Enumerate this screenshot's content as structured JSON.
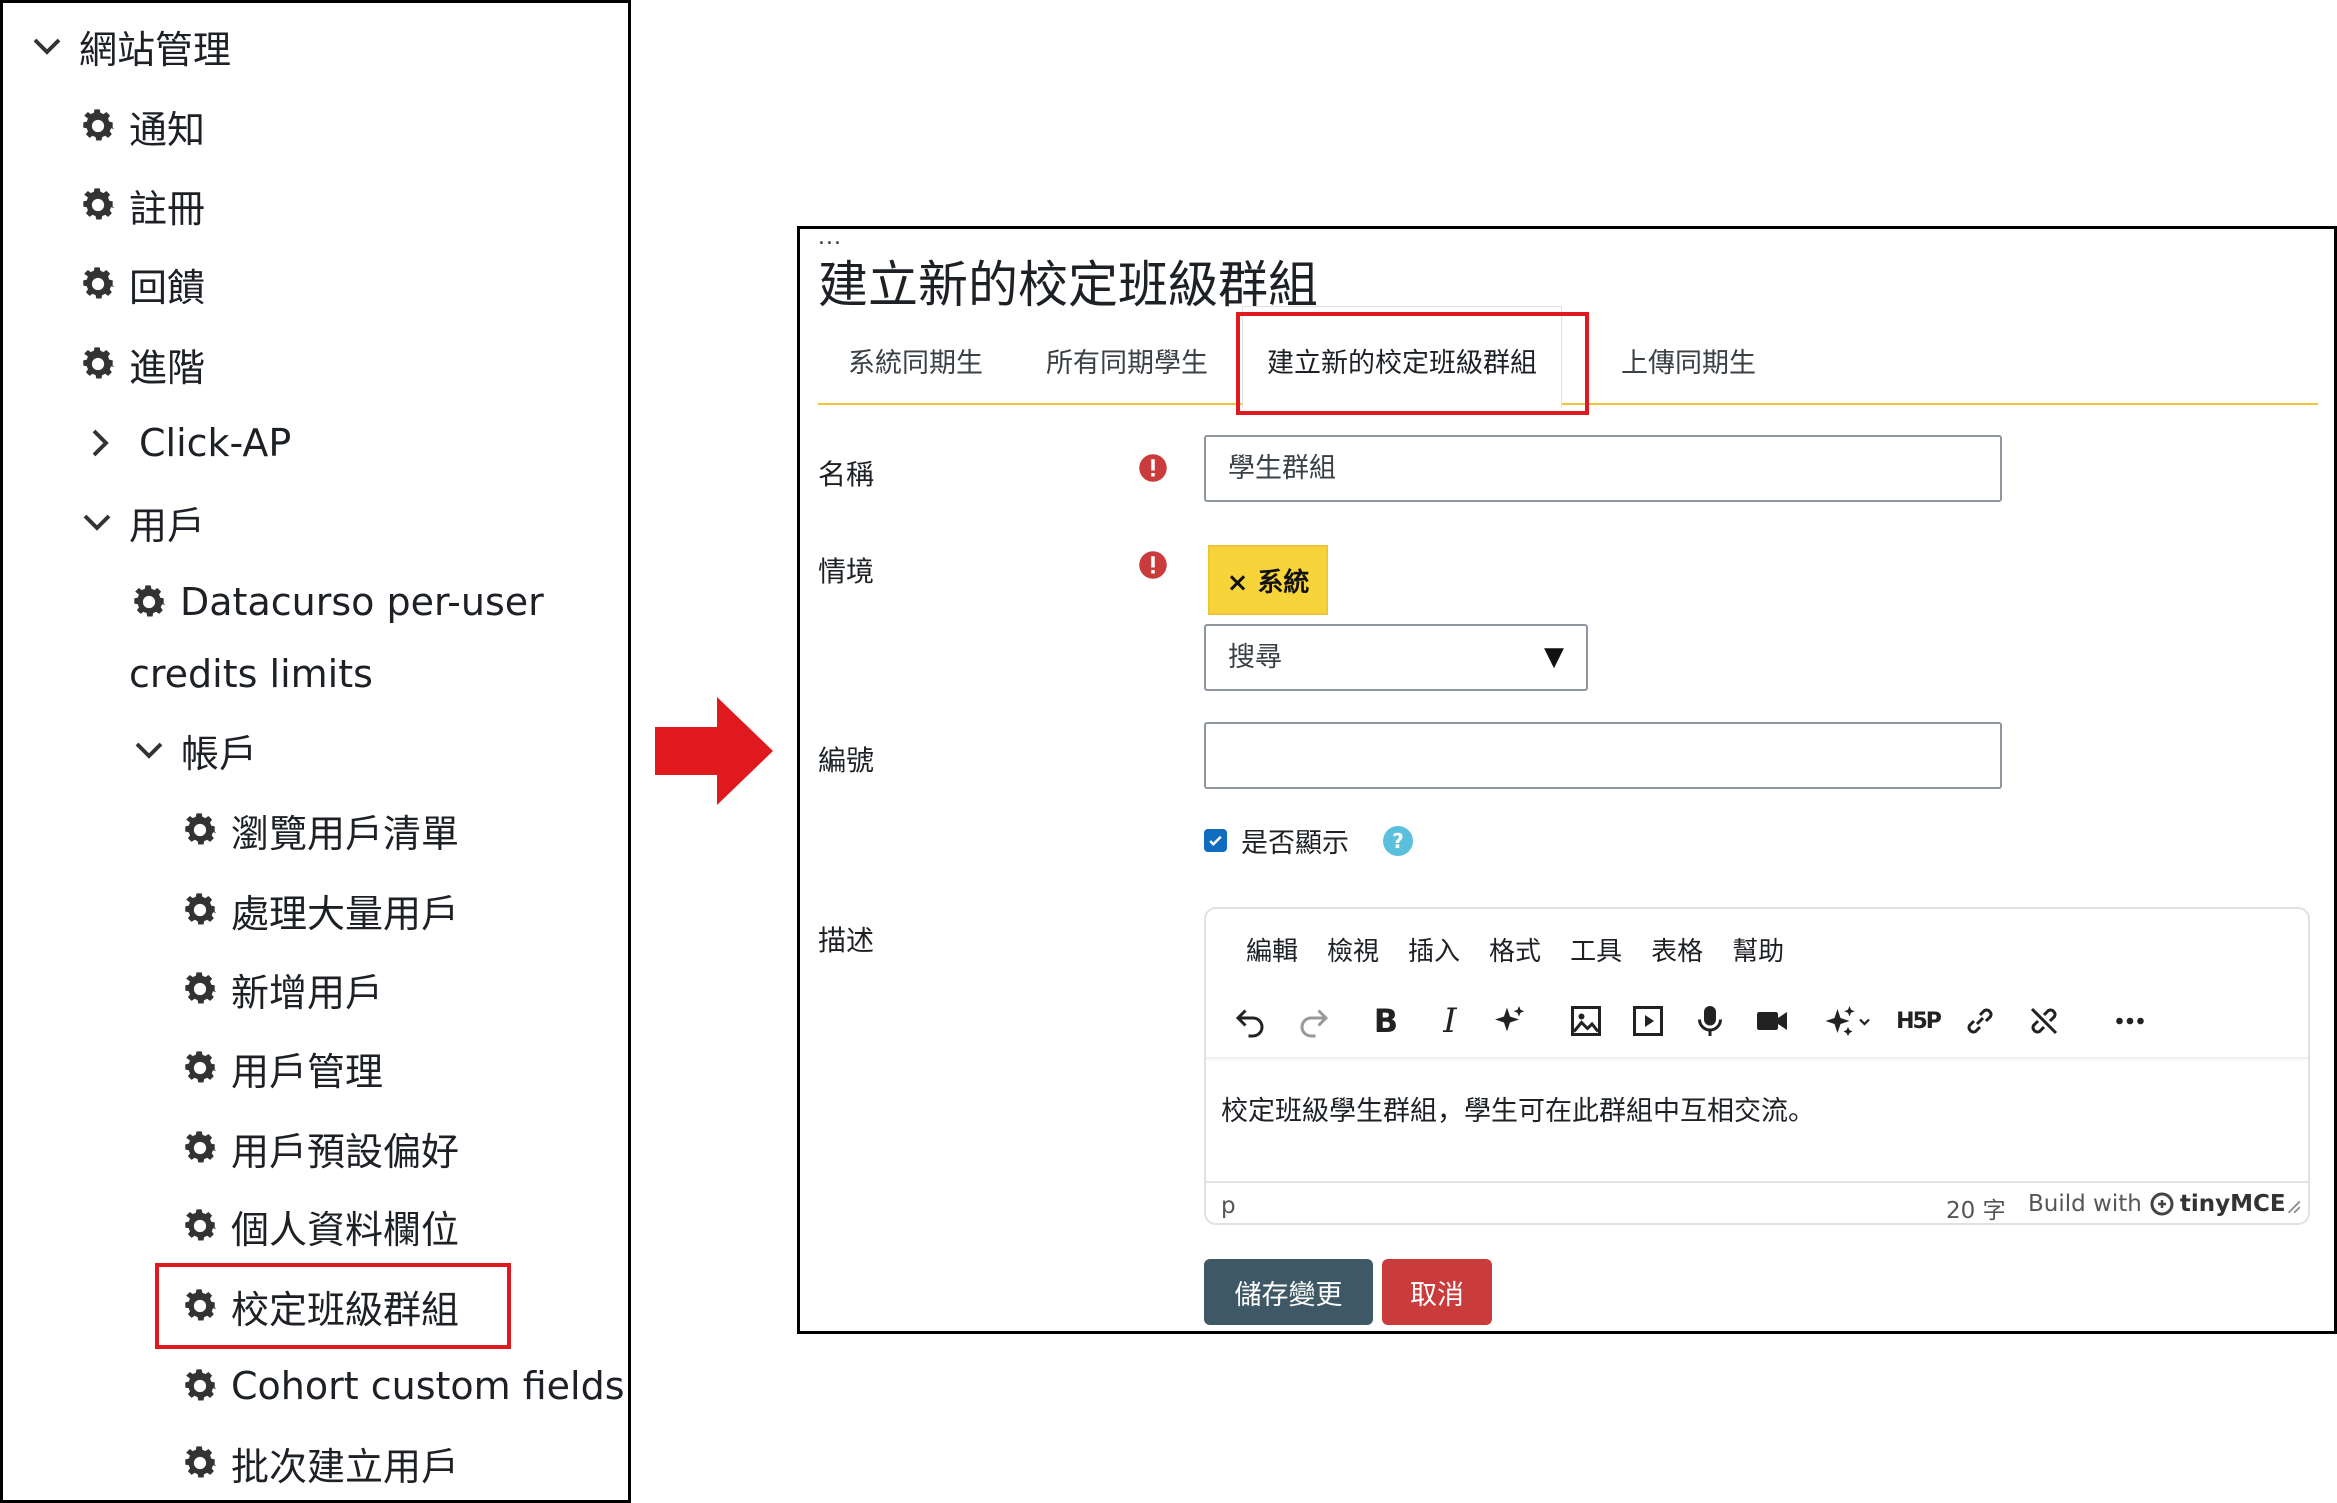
{
  "nav": {
    "items": [
      {
        "label": "網站管理",
        "icon": "chevron-down-icon"
      },
      {
        "label": "通知",
        "icon": "gear-icon"
      },
      {
        "label": "註冊",
        "icon": "gear-icon"
      },
      {
        "label": "回饋",
        "icon": "gear-icon"
      },
      {
        "label": "進階",
        "icon": "gear-icon"
      },
      {
        "label": "Click-AP",
        "icon": "chevron-right-icon"
      },
      {
        "label": "用戶",
        "icon": "chevron-down-icon"
      },
      {
        "label": "Datacurso per-user",
        "icon": "gear-icon"
      },
      {
        "label": "credits limits",
        "icon": ""
      },
      {
        "label": "帳戶",
        "icon": "chevron-down-icon"
      },
      {
        "label": "瀏覽用戶清單",
        "icon": "gear-icon"
      },
      {
        "label": "處理大量用戶",
        "icon": "gear-icon"
      },
      {
        "label": "新增用戶",
        "icon": "gear-icon"
      },
      {
        "label": "用戶管理",
        "icon": "gear-icon"
      },
      {
        "label": "用戶預設偏好",
        "icon": "gear-icon"
      },
      {
        "label": "個人資料欄位",
        "icon": "gear-icon"
      },
      {
        "label": "校定班級群組",
        "icon": "gear-icon"
      },
      {
        "label": "Cohort custom fields",
        "icon": "gear-icon"
      },
      {
        "label": "批次建立用戶",
        "icon": "gear-icon"
      }
    ]
  },
  "form": {
    "ellipsis": "...",
    "title": "建立新的校定班級群組",
    "tabs": [
      {
        "label": "系統同期生"
      },
      {
        "label": "所有同期學生"
      },
      {
        "label": "建立新的校定班級群組"
      },
      {
        "label": "上傳同期生"
      }
    ],
    "name_label": "名稱",
    "name_value": "學生群組",
    "context_label": "情境",
    "context_chip": "× 系統",
    "context_search": "搜尋",
    "caret": "▼",
    "idnumber_label": "編號",
    "idnumber_value": "",
    "visible_label": "是否顯示",
    "help_glyph": "?",
    "description_label": "描述",
    "editor": {
      "menu": [
        "編輯",
        "檢視",
        "插入",
        "格式",
        "工具",
        "表格",
        "幫助"
      ],
      "toolbar_icons": [
        "undo-icon",
        "redo-icon",
        "bold-icon",
        "italic-icon",
        "ai-sparkle-icon",
        "image-icon",
        "media-icon",
        "microphone-icon",
        "video-camera-icon",
        "ai-tools-icon",
        "h5p-icon",
        "link-icon",
        "unlink-icon",
        "more-icon"
      ],
      "bold_glyph": "B",
      "italic_glyph": "I",
      "h5p_text": "H5P",
      "content": "校定班級學生群組，學生可在此群組中互相交流。",
      "status_path": "p",
      "word_count": "20 字",
      "build_with": "Build with",
      "brand": "tinyMCE"
    },
    "save_button": "儲存變更",
    "cancel_button": "取消"
  },
  "colors": {
    "highlight": "#e0191f",
    "chip": "#f7d43a",
    "save": "#3f5866",
    "cancel": "#ca3c3c",
    "required": "#ca3c3c",
    "checkbox": "#0f6cbf",
    "tab_underline": "#f0c433"
  }
}
